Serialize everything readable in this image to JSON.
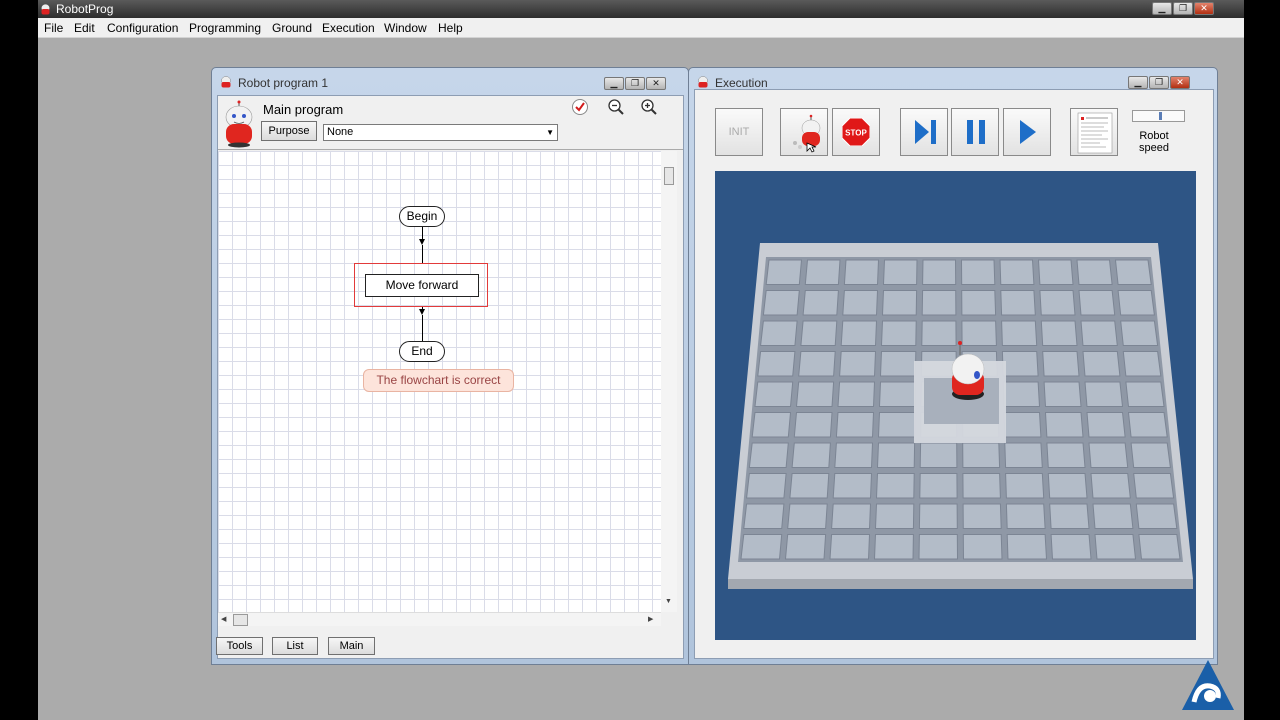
{
  "app": {
    "title": "RobotProg"
  },
  "menu": [
    "File",
    "Edit",
    "Configuration",
    "Programming",
    "Ground",
    "Execution",
    "Window",
    "Help"
  ],
  "program_window": {
    "title": "Robot program 1",
    "main_program_label": "Main program",
    "purpose_button": "Purpose",
    "purpose_select_value": "None",
    "icons": [
      "check-icon",
      "zoom-out-icon",
      "zoom-in-icon"
    ],
    "flowchart": {
      "begin": "Begin",
      "step": "Move forward",
      "end": "End",
      "status": "The flowchart is correct"
    },
    "bottom_tabs": [
      "Tools",
      "List",
      "Main"
    ]
  },
  "execution_window": {
    "title": "Execution",
    "toolbar": {
      "init": "INIT",
      "stop": "STOP",
      "speed_label_1": "Robot",
      "speed_label_2": "speed"
    }
  },
  "colors": {
    "scene_background": "#2e5585",
    "selection_border": "#e23a3a",
    "play_blue": "#1e6ec8",
    "stop_red": "#e01818"
  }
}
